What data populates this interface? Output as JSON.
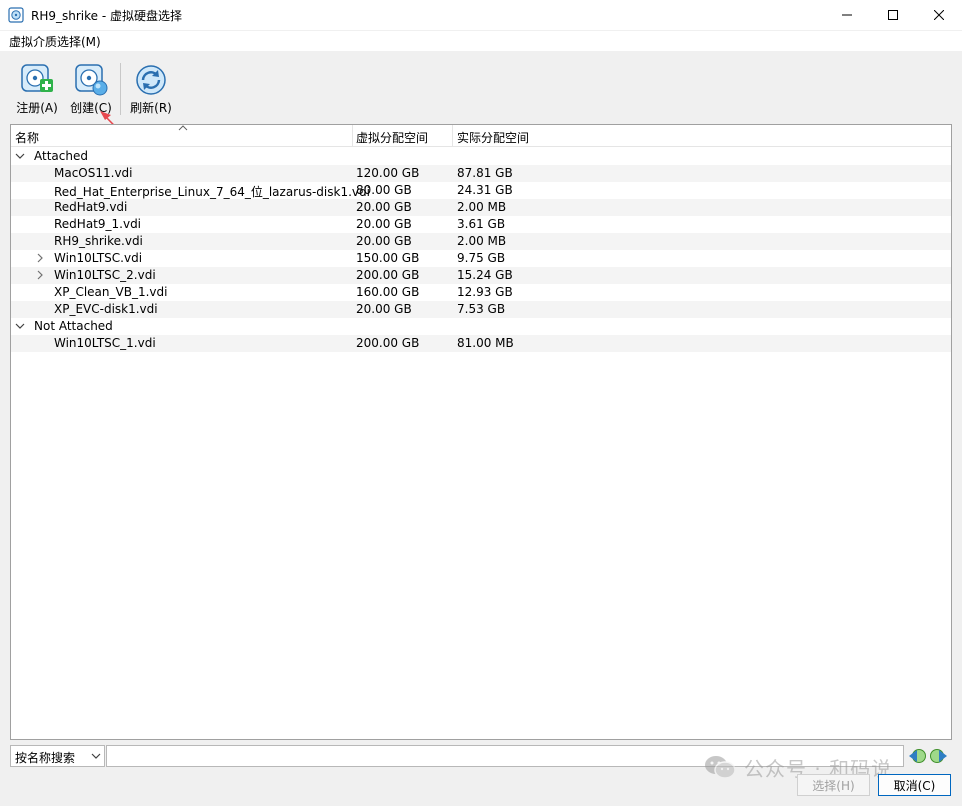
{
  "window": {
    "title": "RH9_shrike - 虚拟硬盘选择"
  },
  "menu": {
    "items": [
      "虚拟介质选择(M)"
    ]
  },
  "toolbar": {
    "register_label": "注册(A)",
    "create_label": "创建(C)",
    "refresh_label": "刷新(R)"
  },
  "table": {
    "columns": [
      "名称",
      "虚拟分配空间",
      "实际分配空间"
    ],
    "groups": [
      {
        "name": "Attached",
        "rows": [
          {
            "name": "MacOS11.vdi",
            "virtual": "120.00 GB",
            "actual": "87.81 GB",
            "expandable": false
          },
          {
            "name": "Red_Hat_Enterprise_Linux_7_64_位_lazarus-disk1.vdi",
            "virtual": "80.00 GB",
            "actual": "24.31 GB",
            "expandable": false
          },
          {
            "name": "RedHat9.vdi",
            "virtual": "20.00 GB",
            "actual": "2.00 MB",
            "expandable": false
          },
          {
            "name": "RedHat9_1.vdi",
            "virtual": "20.00 GB",
            "actual": "3.61 GB",
            "expandable": false
          },
          {
            "name": "RH9_shrike.vdi",
            "virtual": "20.00 GB",
            "actual": "2.00 MB",
            "expandable": false
          },
          {
            "name": "Win10LTSC.vdi",
            "virtual": "150.00 GB",
            "actual": "9.75 GB",
            "expandable": true
          },
          {
            "name": "Win10LTSC_2.vdi",
            "virtual": "200.00 GB",
            "actual": "15.24 GB",
            "expandable": true
          },
          {
            "name": "XP_Clean_VB_1.vdi",
            "virtual": "160.00 GB",
            "actual": "12.93 GB",
            "expandable": false
          },
          {
            "name": "XP_EVC-disk1.vdi",
            "virtual": "20.00 GB",
            "actual": "7.53 GB",
            "expandable": false
          }
        ]
      },
      {
        "name": "Not Attached",
        "rows": [
          {
            "name": "Win10LTSC_1.vdi",
            "virtual": "200.00 GB",
            "actual": "81.00 MB",
            "expandable": false
          }
        ]
      }
    ]
  },
  "search": {
    "mode_value": "按名称搜索",
    "query": ""
  },
  "watermark": {
    "text": "公众号 · 和码说"
  },
  "buttons": {
    "select_label": "选择(H)",
    "cancel_label": "取消(C)"
  },
  "colors": {
    "accent": "#0067c0",
    "arrow": "#e8484f",
    "row_alt": "#f4f4f4"
  }
}
